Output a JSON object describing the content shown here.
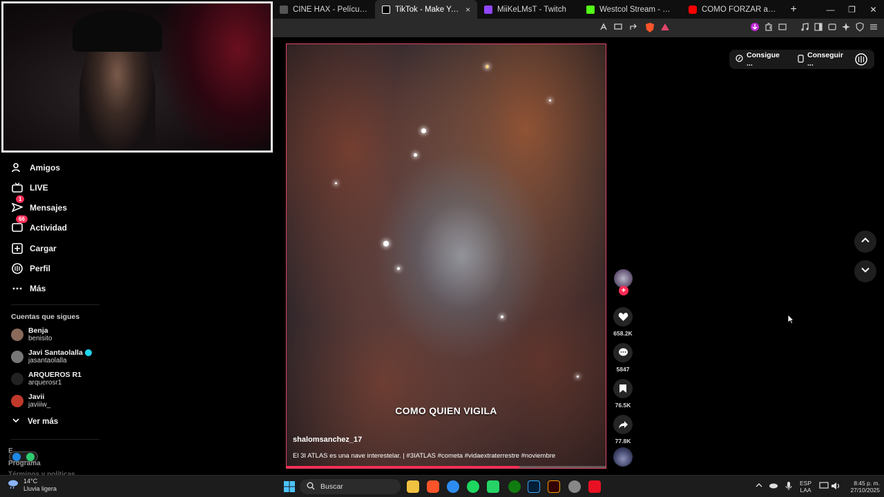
{
  "browser": {
    "tabs": [
      {
        "label": "CINE HAX - Películas y Series GRATIS",
        "favicon_color": "#9aa0a6",
        "icon": "cinehax-favicon"
      },
      {
        "label": "TikTok - Make Your Day",
        "favicon_color": "#ffffff",
        "icon": "tiktok-favicon",
        "active": true,
        "close": "×"
      },
      {
        "label": "MiiKeLMsT - Twitch",
        "favicon_color": "#9146ff",
        "icon": "twitch-favicon"
      },
      {
        "label": "Westcol Stream - Watch Live on Kick",
        "favicon_color": "#53fc18",
        "icon": "kick-favicon"
      },
      {
        "label": "CÓMO FORZAR a tu CEREBRO a...",
        "favicon_color": "#ff0000",
        "icon": "youtube-favicon"
      }
    ],
    "new_tab": "+",
    "window_controls": {
      "minimize": "—",
      "maximize": "❐",
      "close": "✕"
    }
  },
  "sidebar": {
    "nav": [
      {
        "label": "Amigos",
        "icon": "friends-icon"
      },
      {
        "label": "LIVE",
        "icon": "live-icon"
      },
      {
        "label": "Mensajes",
        "icon": "messages-icon",
        "badge": "1"
      },
      {
        "label": "Actividad",
        "icon": "activity-icon",
        "badge": "66"
      },
      {
        "label": "Cargar",
        "icon": "upload-icon"
      },
      {
        "label": "Perfil",
        "icon": "profile-icon"
      },
      {
        "label": "Más",
        "icon": "more-icon"
      }
    ],
    "following_title": "Cuentas que sigues",
    "following": [
      {
        "name": "Benja",
        "username": "benisito",
        "avatar_color": "#8a6a5a"
      },
      {
        "name": "Javi Santaolalla",
        "username": "jasantaolalla",
        "verified": true,
        "avatar_color": "#777777"
      },
      {
        "name": "ARQUEROS R1",
        "username": "arquerosr1",
        "avatar_color": "#222222"
      },
      {
        "name": "Javii",
        "username": "javiiiw_",
        "avatar_color": "#c0392b"
      }
    ],
    "see_more": "Ver más",
    "footer_fragments": [
      "E",
      "Programa",
      "Términos y políticas"
    ]
  },
  "video": {
    "caption_overlay": "COMO QUIEN VIGILA",
    "author": "shalomsanchez_17",
    "description": "El 3I ATLAS es una nave interestelar. | #3IATLAS #cometa #vidaextraterrestre #noviembre",
    "progress_fraction": 0.73
  },
  "actions": {
    "likes": "658.2K",
    "comments": "5847",
    "saves": "76.5K",
    "shares": "77.8K",
    "follow_symbol": "+"
  },
  "top_buttons": {
    "coins": "Consigue ...",
    "app": "Conseguir ..."
  },
  "taskbar": {
    "weather_temp": "14°C",
    "weather_desc": "Lluvia ligera",
    "search_placeholder": "Buscar",
    "lang_1": "ESP",
    "lang_2": "LAA",
    "time": "8:45 p. m.",
    "date": "27/10/2025"
  },
  "colors": {
    "accent": "#fe2c55",
    "video_border": "#e2456a",
    "verified": "#20d5ec"
  }
}
